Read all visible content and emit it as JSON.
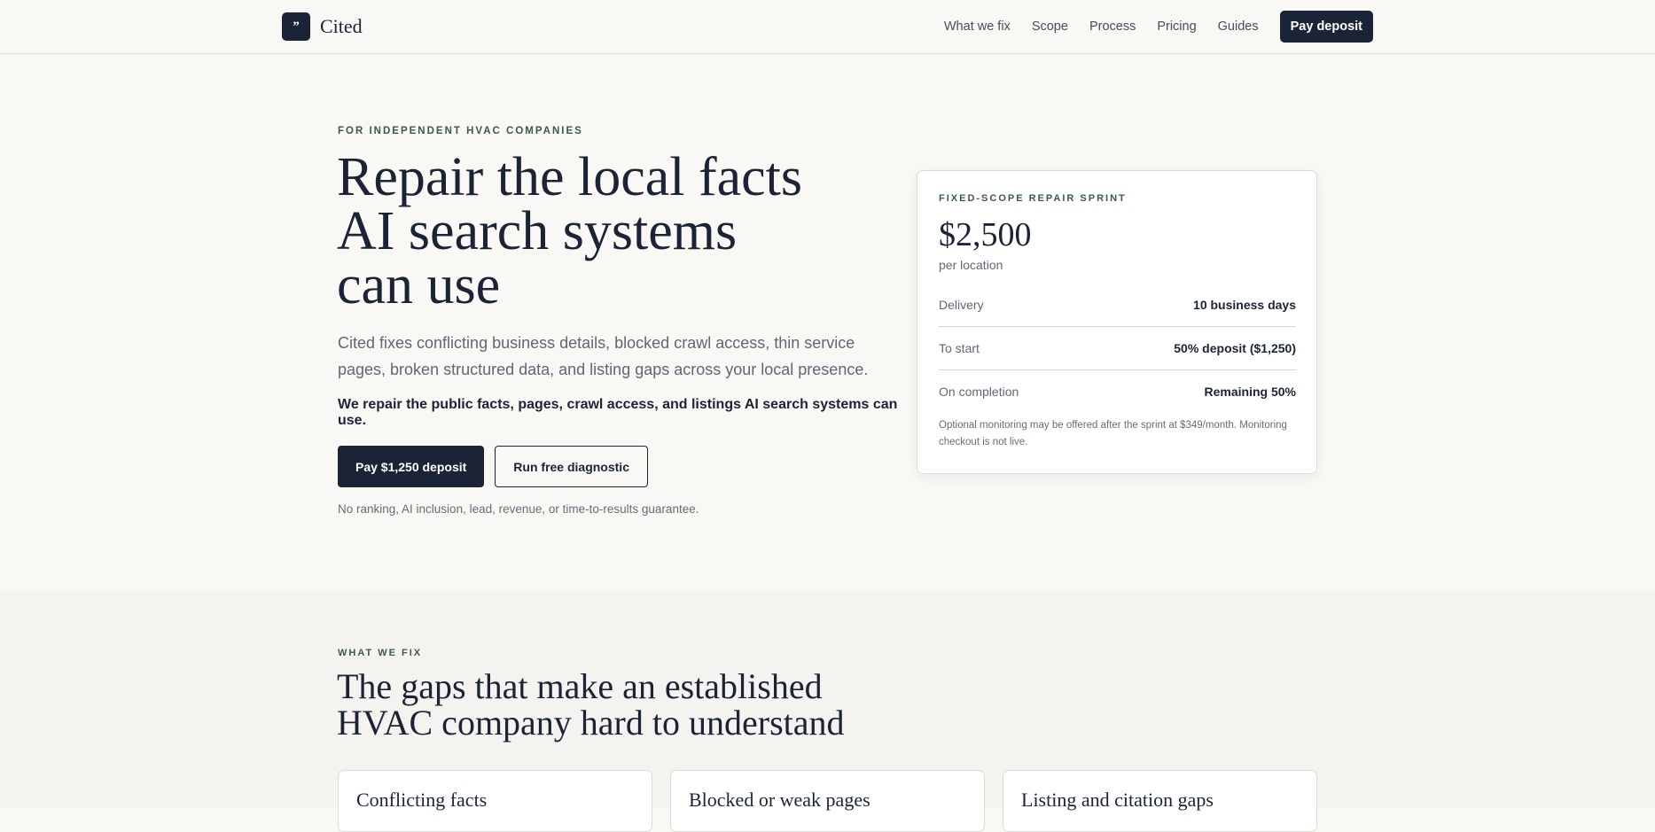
{
  "nav": {
    "logo_glyph": "”",
    "brand": "Cited",
    "links": [
      "What we fix",
      "Scope",
      "Process",
      "Pricing",
      "Guides"
    ],
    "cta": "Pay deposit"
  },
  "hero": {
    "eyebrow": "FOR INDEPENDENT HVAC COMPANIES",
    "title_lines": [
      "Repair the local facts",
      "AI search systems",
      "can use"
    ],
    "subtitle": "Cited fixes conflicting business details, blocked crawl access, thin service pages, broken structured data, and listing gaps across your local presence.",
    "strong_line": "We repair the public facts, pages, crawl access, and listings AI search systems can use.",
    "primary_button": "Pay $1,250 deposit",
    "secondary_button": "Run free diagnostic",
    "note": "No ranking, AI inclusion, lead, revenue, or time-to-results guarantee."
  },
  "price_card": {
    "eyebrow": "FIXED-SCOPE REPAIR SPRINT",
    "price": "$2,500",
    "per": "per location",
    "rows": [
      {
        "label": "Delivery",
        "value": "10 business days"
      },
      {
        "label": "To start",
        "value": "50% deposit ($1,250)"
      },
      {
        "label": "On completion",
        "value": "Remaining 50%"
      }
    ],
    "footnote": "Optional monitoring may be offered after the sprint at $349/month. Monitoring checkout is not live."
  },
  "what_we_fix": {
    "eyebrow": "WHAT WE FIX",
    "title_lines": [
      "The gaps that make an established",
      "HVAC company hard to understand"
    ],
    "cards": [
      "Conflicting facts",
      "Blocked or weak pages",
      "Listing and citation gaps"
    ]
  },
  "colors": {
    "ink": "#1b2436",
    "background": "#f9f8f5",
    "eyebrow_green": "#3a5a4f"
  }
}
